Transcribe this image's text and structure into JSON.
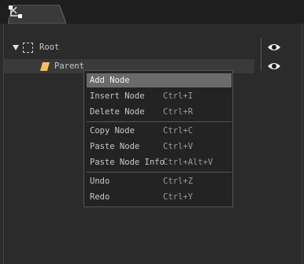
{
  "tab": {
    "icon": "transform-gizmo-icon",
    "close_icon": "close-icon"
  },
  "tree": {
    "root_label": "Root",
    "parent_label": "Parent"
  },
  "context_menu": {
    "items": [
      {
        "label": "Add Node",
        "shortcut": ""
      },
      {
        "label": "Insert Node",
        "shortcut": "Ctrl+I"
      },
      {
        "label": "Delete Node",
        "shortcut": "Ctrl+R"
      },
      {
        "label": "Copy Node",
        "shortcut": "Ctrl+C"
      },
      {
        "label": "Paste Node",
        "shortcut": "Ctrl+V"
      },
      {
        "label": "Paste Node Info",
        "shortcut": "Ctrl+Alt+V"
      },
      {
        "label": "Undo",
        "shortcut": "Ctrl+Z"
      },
      {
        "label": "Redo",
        "shortcut": "Ctrl+Y"
      }
    ]
  },
  "colors": {
    "accent_highlight": "#6a6a6a",
    "folder": "#f3c06a"
  }
}
